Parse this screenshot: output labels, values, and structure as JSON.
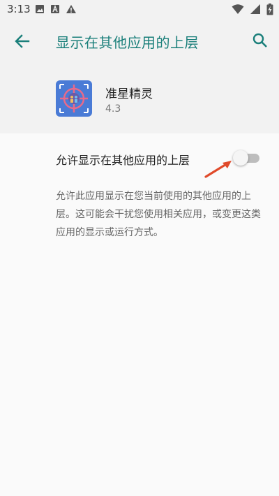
{
  "status_bar": {
    "time": "3:13",
    "left_icons": [
      "image-icon",
      "a-box-icon",
      "warning-icon"
    ],
    "right_icons": [
      "wifi-icon",
      "cellular-signal-icon",
      "battery-charging-icon"
    ]
  },
  "header": {
    "title": "显示在其他应用的上层",
    "back_icon": "arrow-left-icon",
    "search_icon": "search-icon",
    "accent_color": "#1a7f7a"
  },
  "app": {
    "name": "准星精灵",
    "version": "4.3",
    "icon_color": "#4a7bd6"
  },
  "permission": {
    "toggle_label": "允许显示在其他应用的上层",
    "enabled": false
  },
  "description": "允许此应用显示在您当前使用的其他应用的上层。这可能会干扰您使用相关应用，或变更这类应用的显示或运行方式。",
  "annotation": {
    "arrow_color": "#e04a2a"
  }
}
